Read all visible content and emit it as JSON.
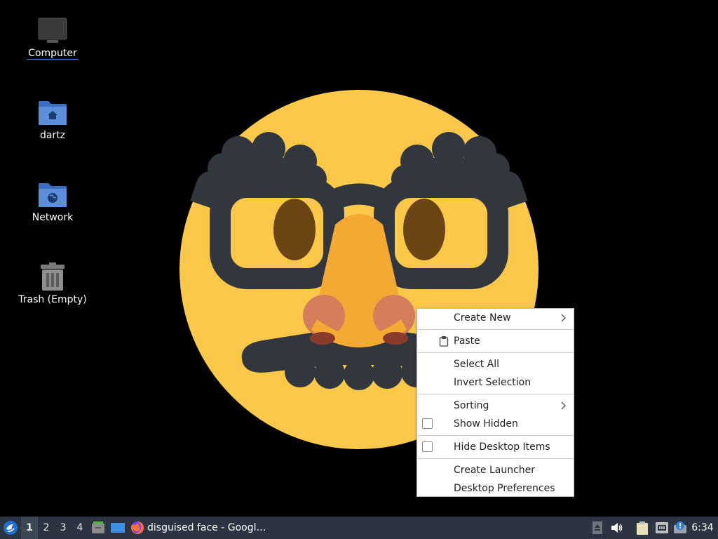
{
  "desktop": {
    "icons": [
      {
        "label": "Computer",
        "icon": "computer-icon"
      },
      {
        "label": "dartz",
        "icon": "home-folder-icon"
      },
      {
        "label": "Network",
        "icon": "network-folder-icon"
      },
      {
        "label": "Trash (Empty)",
        "icon": "trash-icon"
      }
    ],
    "wallpaper": "disguised-face-emoji",
    "colors": {
      "face": "#fcc84a",
      "glasses": "#31373d",
      "nose": "#f4a933",
      "eyes": "#6b4514"
    }
  },
  "context_menu": {
    "items": {
      "create_new": "Create New",
      "paste": "Paste",
      "select_all": "Select All",
      "invert_selection": "Invert Selection",
      "sorting": "Sorting",
      "show_hidden": "Show Hidden",
      "hide_desktop_items": "Hide Desktop Items",
      "create_launcher": "Create Launcher",
      "desktop_preferences": "Desktop Preferences"
    }
  },
  "taskbar": {
    "workspaces": [
      "1",
      "2",
      "3",
      "4"
    ],
    "active_workspace": "1",
    "task_title": "disguised face - Googl…",
    "clock": "6:34",
    "tray_icons": [
      "eject-icon",
      "volume-icon",
      "clipboard-icon",
      "network-icon",
      "update-icon"
    ],
    "color": "#2b3440"
  }
}
